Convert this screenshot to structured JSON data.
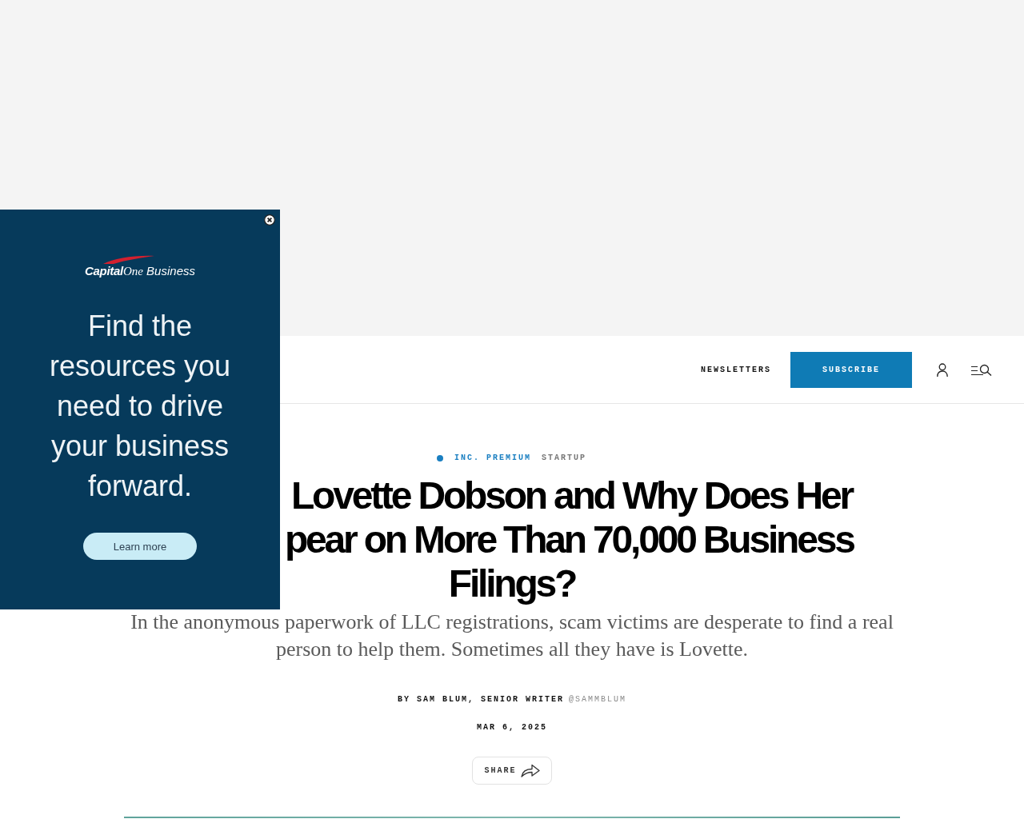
{
  "header": {
    "newsletters": "NEWSLETTERS",
    "subscribe": "SUBSCRIBE"
  },
  "ad": {
    "logo": [
      "Capital",
      "One",
      "Business"
    ],
    "headline": "Find the resources you need to drive your business forward.",
    "cta": "Learn more"
  },
  "article": {
    "tags": [
      {
        "kind": "premium",
        "label": "INC. PREMIUM"
      },
      {
        "kind": "category",
        "label": "STARTUP"
      }
    ],
    "headline_lines": [
      "Lovette Dobson and Why Does Her",
      "pear on More Than 70,000 Business",
      "Filings?"
    ],
    "dek": "In the anonymous paperwork of LLC registrations, scam victims are desperate to find a real person to help them. Sometimes all they have is Lovette.",
    "byline": {
      "text": "BY SAM BLUM, SENIOR WRITER",
      "handle": "@SAMMBLUM"
    },
    "date": "MAR 6, 2025",
    "share": "SHARE"
  }
}
